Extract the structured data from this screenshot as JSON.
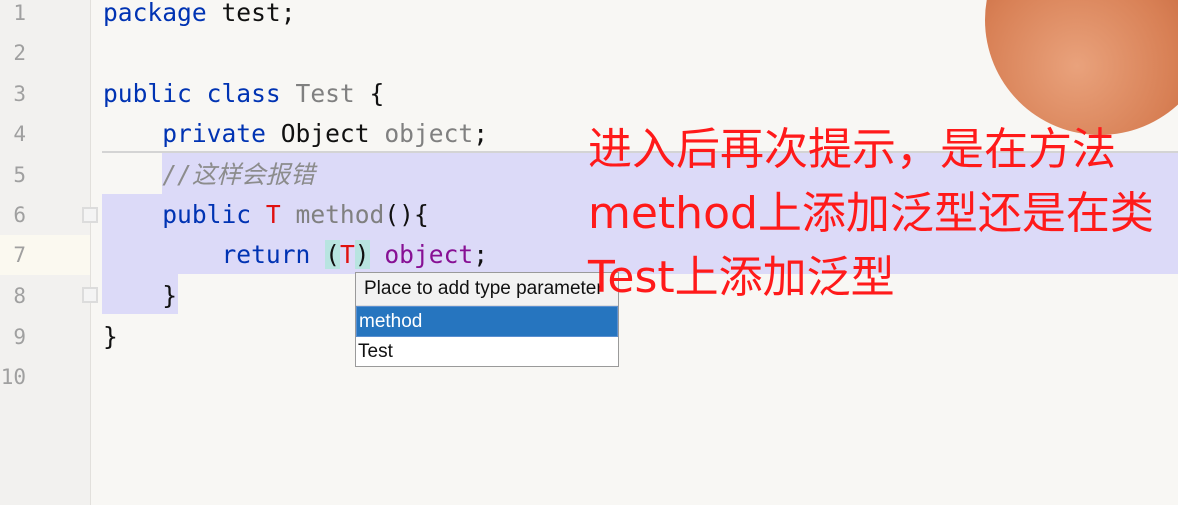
{
  "editor": {
    "line_numbers": [
      "1",
      "2",
      "3",
      "4",
      "5",
      "6",
      "7",
      "8",
      "9",
      "10"
    ],
    "lines": {
      "l1": {
        "kw": "package",
        "rest": " test;"
      },
      "l3": {
        "kw1": "public",
        "kw2": "class",
        "name": "Test",
        "rest": " {"
      },
      "l4": {
        "kw": "private",
        "type": "Object",
        "field": "object",
        "rest": ";"
      },
      "l5": {
        "comment": "//这样会报错"
      },
      "l6": {
        "kw": "public",
        "tparam": "T",
        "name": "method",
        "rest": "(){"
      },
      "l7": {
        "kw": "return",
        "open": "(",
        "tparam": "T",
        "close": ")",
        "field": "object",
        "rest": ";"
      },
      "l8": {
        "text": "}"
      },
      "l9": {
        "text": "}"
      }
    }
  },
  "popup": {
    "title": "Place to add type parameter",
    "items": [
      {
        "label": "method",
        "selected": true
      },
      {
        "label": "Test",
        "selected": false
      }
    ]
  },
  "annotation": {
    "text": "进入后再次提示，是在方法method上添加泛型还是在类Test上添加泛型",
    "color": "#ff1a1a"
  },
  "colors": {
    "keyword": "#0033b3",
    "type_param": "#e01010",
    "selection": "#dcdaf8",
    "popup_selected": "#2675bf"
  }
}
